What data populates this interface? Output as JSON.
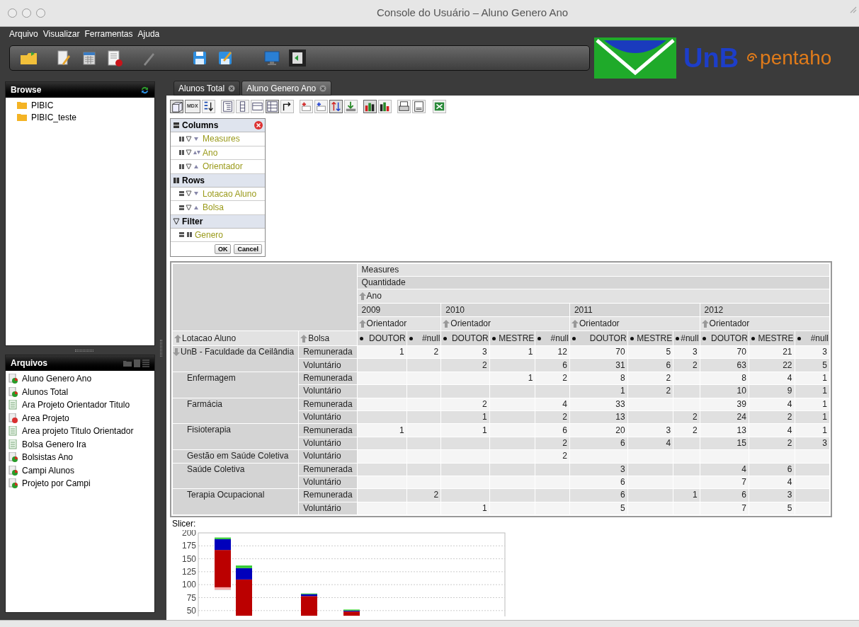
{
  "window": {
    "title": "Console do Usuário – Aluno Genero Ano"
  },
  "menu": [
    "Arquivo",
    "Visualizar",
    "Ferramentas",
    "Ajuda"
  ],
  "logo": {
    "unb": "UnB",
    "pentaho": "pentaho"
  },
  "browse": {
    "title": "Browse",
    "folders": [
      "PIBIC",
      "PIBIC_teste"
    ]
  },
  "files": {
    "title": "Arquivos",
    "items": [
      {
        "label": "Aluno Genero Ano",
        "kind": "chart"
      },
      {
        "label": "Alunos Total",
        "kind": "chart"
      },
      {
        "label": "Ara Projeto Orientador Titulo",
        "kind": "report"
      },
      {
        "label": "Area Projeto",
        "kind": "alert"
      },
      {
        "label": "Area projeto Titulo Orientador",
        "kind": "report"
      },
      {
        "label": "Bolsa Genero Ira",
        "kind": "report"
      },
      {
        "label": "Bolsistas Ano",
        "kind": "chart"
      },
      {
        "label": "Campi Alunos",
        "kind": "chart"
      },
      {
        "label": "Projeto por Campi",
        "kind": "chart"
      }
    ]
  },
  "tabs": [
    {
      "label": "Alunos Total",
      "selected": false
    },
    {
      "label": "Aluno Genero Ano",
      "selected": true
    }
  ],
  "pivot_toolbar": {
    "mdx": "MDX"
  },
  "navigator": {
    "sections": [
      {
        "title": "Columns",
        "kind": "columns",
        "items": [
          {
            "label": "Measures",
            "kind": "desc"
          },
          {
            "label": "Ano",
            "kind": "both"
          },
          {
            "label": "Orientador",
            "kind": "asc"
          }
        ]
      },
      {
        "title": "Rows",
        "kind": "rows",
        "items": [
          {
            "label": "Lotacao Aluno",
            "kind": "desc"
          },
          {
            "label": "Bolsa",
            "kind": "asc"
          }
        ]
      },
      {
        "title": "Filter",
        "kind": "filter",
        "items": [
          {
            "label": "Genero",
            "kind": "filter"
          }
        ]
      }
    ],
    "buttons": [
      "OK",
      "Cancel"
    ]
  },
  "table": {
    "measures": "Measures",
    "measure": "Quantidade",
    "year_dimension": "Ano",
    "row_dimension": "Lotacao Aluno",
    "bolsa_dimension": "Bolsa",
    "years": [
      {
        "label": "2009",
        "dimension": "Orientador",
        "members": [
          "DOUTOR",
          "#null"
        ]
      },
      {
        "label": "2010",
        "dimension": "Orientador",
        "members": [
          "DOUTOR",
          "MESTRE",
          "#null"
        ]
      },
      {
        "label": "2011",
        "dimension": "Orientador",
        "members": [
          "DOUTOR",
          "MESTRE",
          "#null"
        ]
      },
      {
        "label": "2012",
        "dimension": "Orientador",
        "members": [
          "DOUTOR",
          "MESTRE",
          "#null"
        ]
      }
    ],
    "groups": [
      {
        "label": "UnB - Faculdade da Ceilândia",
        "kind": "parent",
        "rows": [
          {
            "bolsa": "Remunerada",
            "cells": [
              "1",
              "2",
              "3",
              "1",
              "12",
              "70",
              "5",
              "3",
              "70",
              "21",
              "3"
            ]
          },
          {
            "bolsa": "Voluntário",
            "cells": [
              null,
              null,
              "2",
              null,
              "6",
              "31",
              "6",
              "2",
              "63",
              "22",
              "5"
            ]
          }
        ]
      },
      {
        "label": "Enfermagem",
        "kind": "child",
        "rows": [
          {
            "bolsa": "Remunerada",
            "cells": [
              null,
              null,
              null,
              "1",
              "2",
              "8",
              "2",
              null,
              "8",
              "4",
              "1"
            ]
          },
          {
            "bolsa": "Voluntário",
            "cells": [
              null,
              null,
              null,
              null,
              null,
              "1",
              "2",
              null,
              "10",
              "9",
              "1"
            ]
          }
        ]
      },
      {
        "label": "Farmácia",
        "kind": "child",
        "rows": [
          {
            "bolsa": "Remunerada",
            "cells": [
              null,
              null,
              "2",
              null,
              "4",
              "33",
              null,
              null,
              "39",
              "4",
              "1"
            ]
          },
          {
            "bolsa": "Voluntário",
            "cells": [
              null,
              null,
              "1",
              null,
              "2",
              "13",
              null,
              "2",
              "24",
              "2",
              "1"
            ]
          }
        ]
      },
      {
        "label": "Fisioterapia",
        "kind": "child",
        "rows": [
          {
            "bolsa": "Remunerada",
            "cells": [
              "1",
              null,
              "1",
              null,
              "6",
              "20",
              "3",
              "2",
              "13",
              "4",
              "1"
            ]
          },
          {
            "bolsa": "Voluntário",
            "cells": [
              null,
              null,
              null,
              null,
              "2",
              "6",
              "4",
              null,
              "15",
              "2",
              "3"
            ]
          }
        ]
      },
      {
        "label": "Gestão em Saúde Coletiva",
        "kind": "child",
        "rows": [
          {
            "bolsa": "Voluntário",
            "cells": [
              null,
              null,
              null,
              null,
              "2",
              null,
              null,
              null,
              null,
              null,
              null
            ]
          }
        ]
      },
      {
        "label": "Saúde Coletiva",
        "kind": "child",
        "rows": [
          {
            "bolsa": "Remunerada",
            "cells": [
              null,
              null,
              null,
              null,
              null,
              "3",
              null,
              null,
              "4",
              "6",
              null
            ]
          },
          {
            "bolsa": "Voluntário",
            "cells": [
              null,
              null,
              null,
              null,
              null,
              "6",
              null,
              null,
              "7",
              "4",
              null
            ]
          }
        ]
      },
      {
        "label": "Terapia Ocupacional",
        "kind": "child",
        "rows": [
          {
            "bolsa": "Remunerada",
            "cells": [
              null,
              "2",
              null,
              null,
              null,
              "6",
              null,
              "1",
              "6",
              "3",
              null
            ]
          },
          {
            "bolsa": "Voluntário",
            "cells": [
              null,
              null,
              "1",
              null,
              null,
              "5",
              null,
              null,
              "7",
              "5",
              null
            ]
          }
        ]
      }
    ]
  },
  "slicer": "Slicer:",
  "chart": {
    "y_axis_labels": [
      "200",
      "175",
      "150",
      "125",
      "100",
      "75",
      "50"
    ]
  }
}
